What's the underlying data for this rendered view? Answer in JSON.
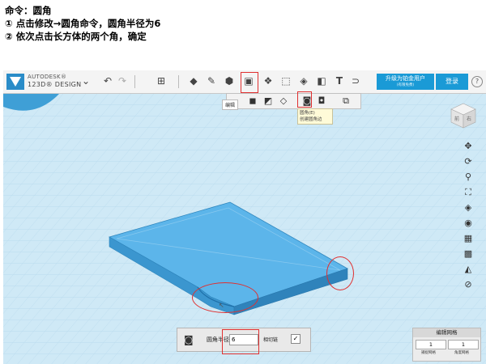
{
  "instructions": {
    "title": "命令：圆角",
    "step1": "①  点击修改→圆角命令，圆角半径为6",
    "step2": "②  依次点击长方体的两个角，确定"
  },
  "app": {
    "brand_line1": "AUTODESK®",
    "brand_line2": "123D® DESIGN",
    "upgrade_label": "升级为铂金用户",
    "upgrade_sub": "(有限免费)",
    "login_label": "登录",
    "help_label": "?"
  },
  "toolbar": {
    "icons": [
      "undo-icon",
      "redo-icon",
      "add-shape-icon",
      "primitives-icon",
      "sketch-icon",
      "construct-icon",
      "modify-icon",
      "pattern-icon",
      "grouping-icon",
      "combine-icon",
      "measure-icon",
      "text-icon",
      "snap-icon",
      "material-icon"
    ]
  },
  "submenu": {
    "label": "编辑",
    "tooltip_title": "圆角(E)",
    "tooltip_desc": "创建圆角边"
  },
  "fillet_panel": {
    "label": "圆角半径",
    "value": "6",
    "tangent_label": "相切链",
    "check": "✓"
  },
  "grid_editor": {
    "title": "编辑网格",
    "val1": "1",
    "val2": "1",
    "cap1": "捕捉网格",
    "cap2": "角度网格"
  },
  "viewcube": {
    "face1": "前",
    "face2": "右"
  },
  "colors": {
    "accent": "#1a9ad6",
    "grid_bg": "#cfe9f6",
    "box_top": "#5cb5ea",
    "box_side": "#3b96cf",
    "highlight": "#e03030"
  }
}
